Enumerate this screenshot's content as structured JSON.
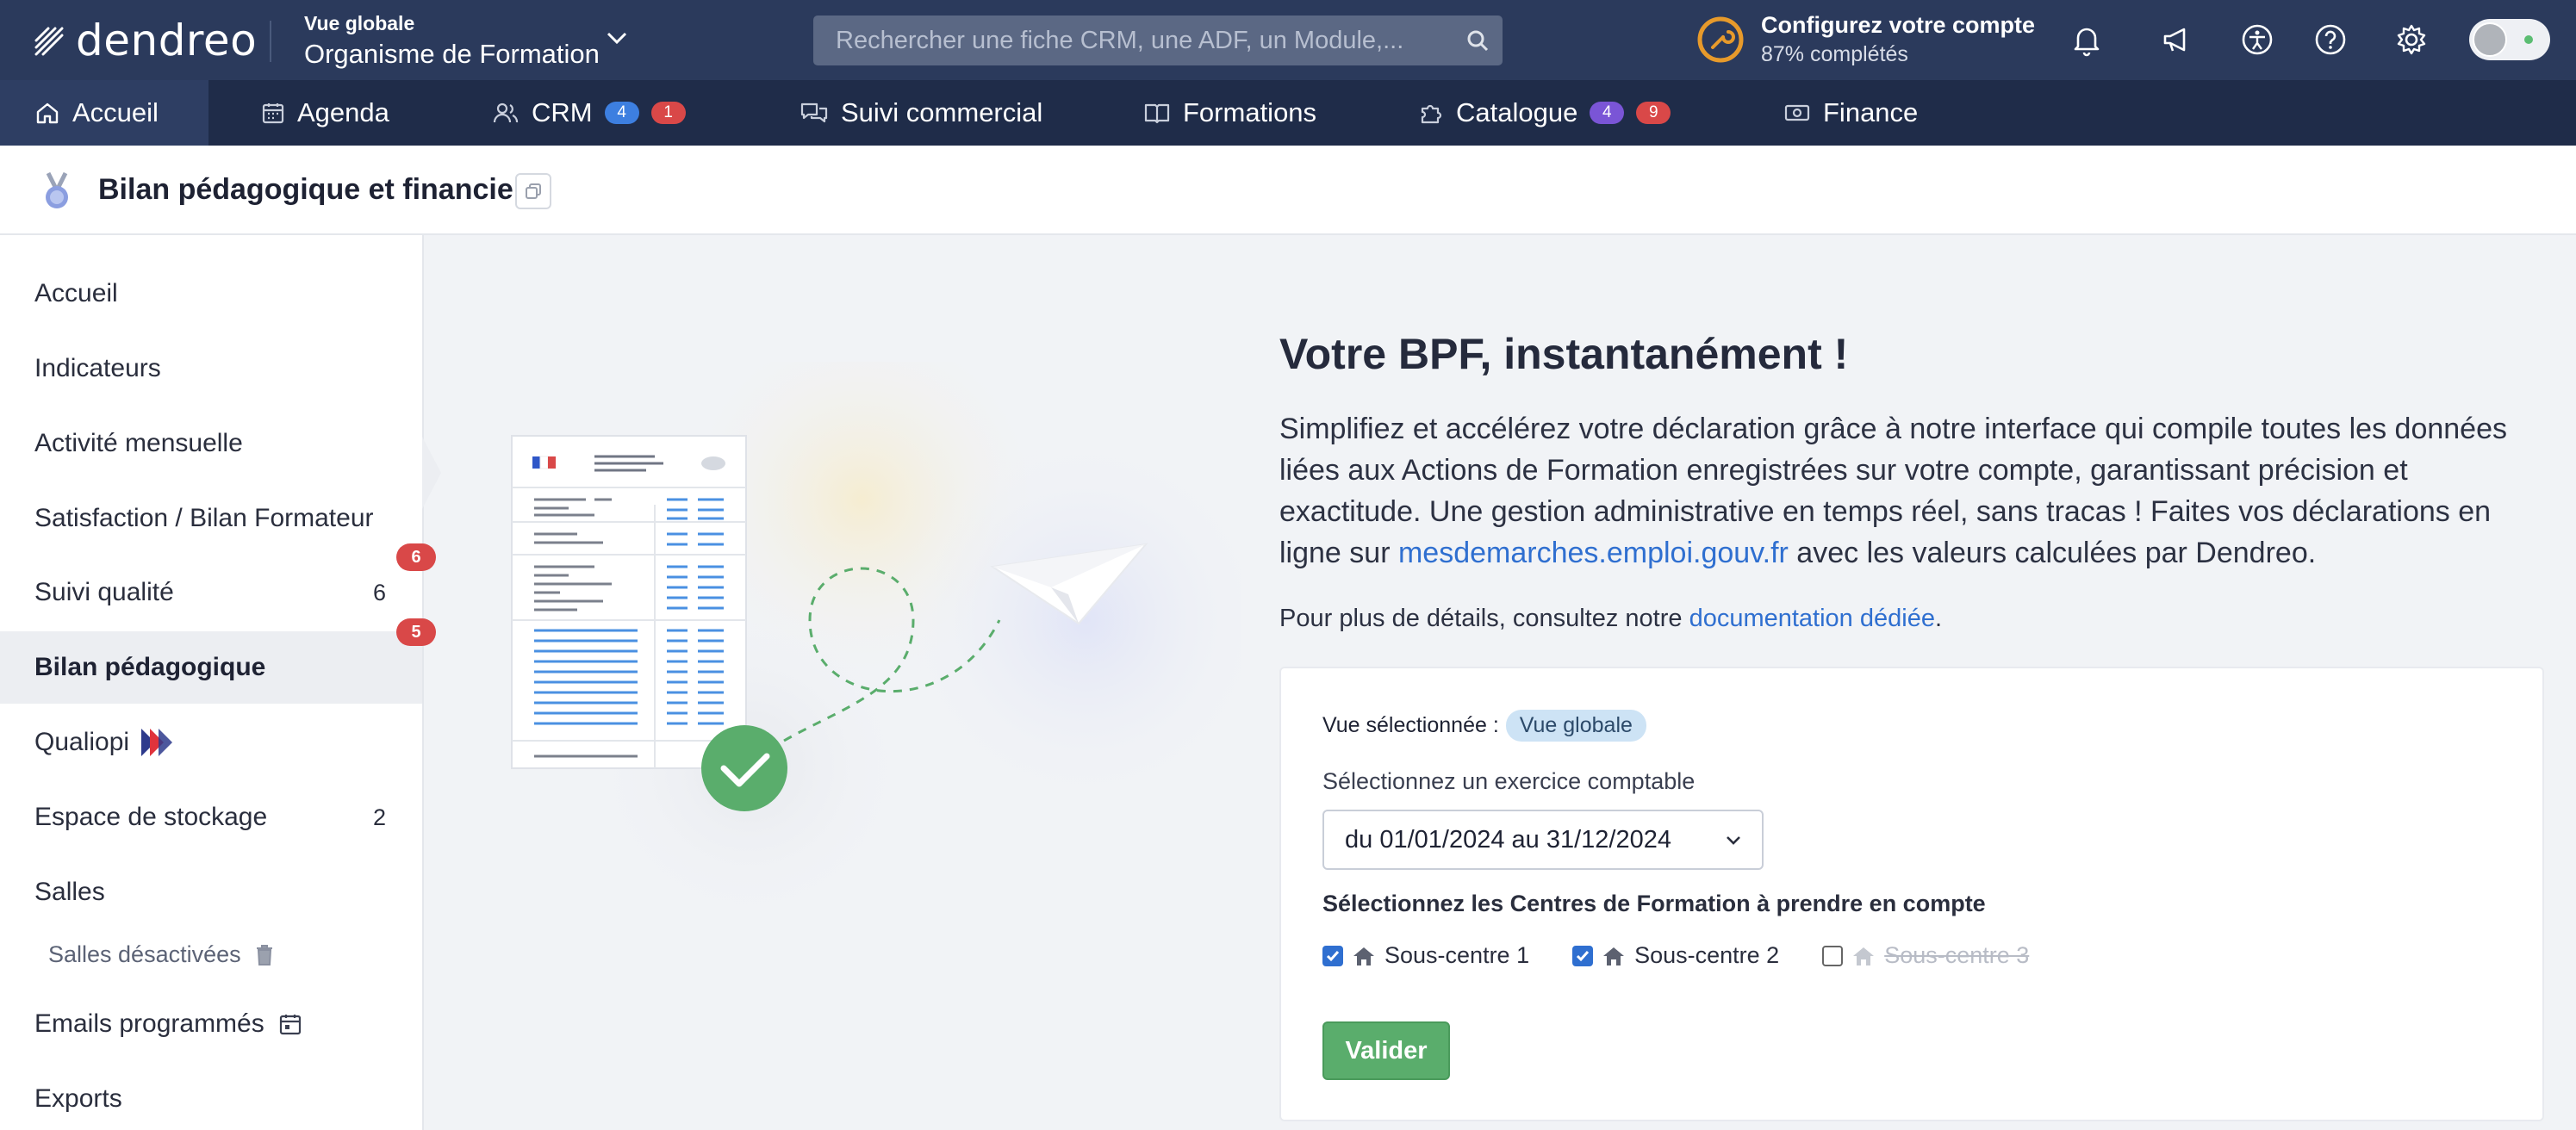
{
  "app": {
    "logo_text": "dendreo"
  },
  "header": {
    "view_small": "Vue globale",
    "view_big": "Organisme de Formation",
    "search_placeholder": "Rechercher une fiche CRM, une ADF, un Module,...",
    "configure_title": "Configurez votre compte",
    "configure_progress_label": "87% complétés",
    "configure_progress": 0.87
  },
  "nav": {
    "items": [
      {
        "label": "Accueil",
        "icon": "home-icon"
      },
      {
        "label": "Agenda",
        "icon": "calendar-icon"
      },
      {
        "label": "CRM",
        "icon": "users-icon",
        "badges": [
          "4",
          "1"
        ]
      },
      {
        "label": "Suivi commercial",
        "icon": "chat-icon"
      },
      {
        "label": "Formations",
        "icon": "book-icon"
      },
      {
        "label": "Catalogue",
        "icon": "puzzle-icon",
        "badges": [
          "4",
          "9"
        ]
      },
      {
        "label": "Finance",
        "icon": "money-icon"
      }
    ]
  },
  "page": {
    "title": "Bilan pédagogique et financier"
  },
  "sidebar": {
    "items": [
      {
        "label": "Accueil"
      },
      {
        "label": "Indicateurs"
      },
      {
        "label": "Activité mensuelle"
      },
      {
        "label": "Satisfaction / Bilan Formateur"
      },
      {
        "label": "Suivi qualité",
        "count": "6",
        "notif": "6"
      },
      {
        "label": "Bilan pédagogique",
        "notif": "5"
      },
      {
        "label": "Qualiopi"
      },
      {
        "label": "Espace de stockage",
        "count": "2"
      },
      {
        "label": "Salles"
      },
      {
        "label": "Salles désactivées"
      },
      {
        "label": "Emails programmés"
      },
      {
        "label": "Exports"
      }
    ]
  },
  "main": {
    "title": "Votre BPF, instantanément !",
    "desc_1": "Simplifiez et accélérez votre déclaration grâce à notre interface qui compile toutes les données liées aux Actions de Formation enregistrées sur votre compte, garantissant précision et exactitude. Une gestion administrative en temps réel, sans tracas ! Faites vos déclarations en ligne sur ",
    "desc_link": "mesdemarches.emploi.gouv.fr",
    "desc_2": " avec les valeurs calculées par Dendreo.",
    "more_1": "Pour plus de détails, consultez notre ",
    "more_link": "documentation dédiée",
    "more_2": "."
  },
  "form": {
    "view_label": "Vue sélectionnée :",
    "view_value": "Vue globale",
    "exercise_label": "Sélectionnez un exercice comptable",
    "exercise_value": "du 01/01/2024 au 31/12/2024",
    "centers_label": "Sélectionnez les Centres de Formation à prendre en compte",
    "centers": [
      {
        "label": "Sous-centre 1",
        "checked": true
      },
      {
        "label": "Sous-centre 2",
        "checked": true
      },
      {
        "label": "Sous-centre 3",
        "checked": false
      }
    ],
    "submit": "Valider"
  },
  "colors": {
    "topbar": "#2b3a5c",
    "navbar": "#1f2c49",
    "accent": "#2f6fd0",
    "success": "#5aad6c",
    "badge_red": "#d94848"
  }
}
